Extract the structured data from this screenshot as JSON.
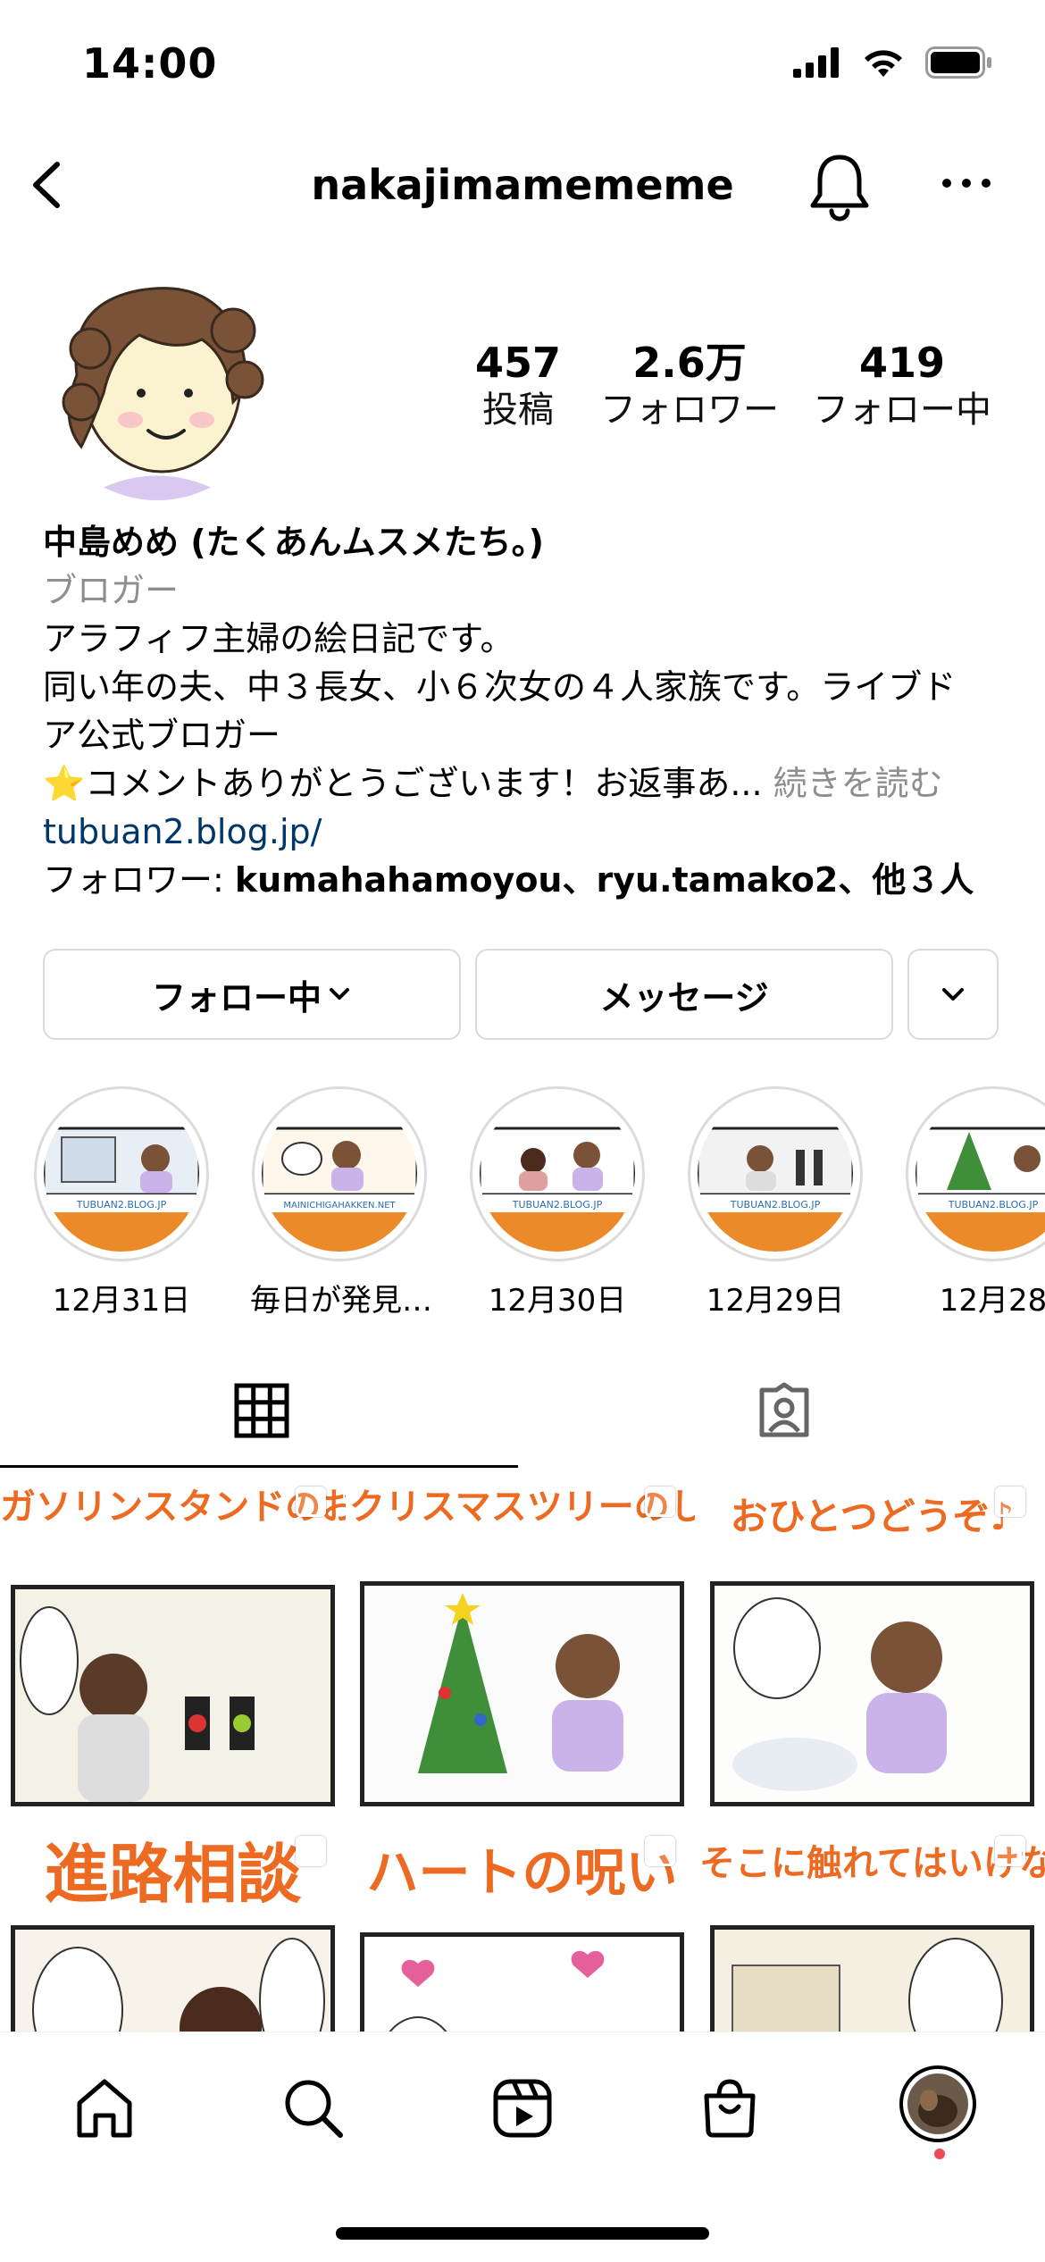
{
  "status_bar": {
    "time": "14:00"
  },
  "header": {
    "username": "nakajimamememe"
  },
  "profile": {
    "stats": [
      {
        "value": "457",
        "label": "投稿"
      },
      {
        "value": "2.6万",
        "label": "フォロワー"
      },
      {
        "value": "419",
        "label": "フォロー中"
      }
    ],
    "name": "中島めめ (たくあんムスメたち。)",
    "category": "ブロガー",
    "bio_line1": "アラフィフ主婦の絵日記です。",
    "bio_line2": "同い年の夫、中３長女、小６次女の４人家族です。ライブド",
    "bio_line3": "ア公式ブロガー",
    "bio_line4_emoji": "⭐",
    "bio_line4_text": "コメントありがとうございます！お返事あ... ",
    "bio_more": "続きを読む",
    "link": "tubuan2.blog.jp/",
    "followed_by_prefix": "フォロワー: ",
    "followed_by_user1": "kumahahamoyou",
    "followed_by_sep": "、",
    "followed_by_user2": "ryu.tamako2",
    "followed_by_suffix": "、他３人"
  },
  "buttons": {
    "following": "フォロー中",
    "message": "メッセージ"
  },
  "highlights": [
    {
      "label": "12月31日",
      "url_text": "TUBUAN2.BLOG.JP"
    },
    {
      "label": "毎日が発見…",
      "url_text": "MAINICHIGAHAKKEN.NET"
    },
    {
      "label": "12月30日",
      "url_text": "TUBUAN2.BLOG.JP"
    },
    {
      "label": "12月29日",
      "url_text": "TUBUAN2.BLOG.JP"
    },
    {
      "label": "12月28",
      "url_text": "TUBUAN2.BLOG.JP"
    }
  ],
  "posts": [
    {
      "title": "ガソリンスタンドのお姉さん"
    },
    {
      "title": "クリスマスツリーのしまい方"
    },
    {
      "title": "おひとつどうぞ♪"
    },
    {
      "title": "進路相談"
    },
    {
      "title": "ハートの呪い"
    },
    {
      "title": "そこに触れてはいけない"
    }
  ],
  "colors": {
    "accent_orange": "#ec6a21",
    "link_blue": "#00376b",
    "muted_gray": "#8e8e8e",
    "border_gray": "#dbdbdb",
    "notification_red": "#ed4956"
  }
}
